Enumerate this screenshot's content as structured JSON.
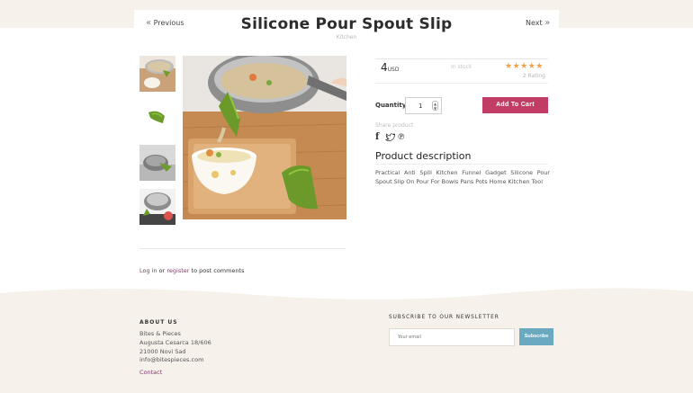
{
  "nav": {
    "previous": "Previous",
    "next": "Next",
    "prev_icon": "chevron-double-left-icon",
    "next_icon": "chevron-double-right-icon"
  },
  "product": {
    "title": "Silicone Pour Spout Slip",
    "category": "Kitchen",
    "price": "4",
    "currency": "USD",
    "stock": "In stock",
    "stars": "★★★★★",
    "rating_value": 5,
    "rating_text": "2 Rating",
    "quantity_label": "Quantity",
    "quantity": "1",
    "add_to_cart": "Add To Cart",
    "share_label": "Share product",
    "share_icons": [
      "facebook-icon",
      "twitter-icon",
      "pinterest-icon"
    ],
    "description_title": "Product description",
    "description": "Practical Anti Spill Kitchen Funnel Gadget Silicone Pour Spout Slip On Pour For Bowls Pans Pots Home Kitchen Tool"
  },
  "comments": {
    "login": "Log in",
    "or": " or ",
    "register": "register",
    "suffix": " to post comments"
  },
  "footer": {
    "about_title": "ABOUT US",
    "address": [
      "Bites & Pieces",
      "Augusta Cesarca 18/606",
      "21000 Novi Sad",
      "info@bitespieces.com"
    ],
    "contact": "Contact",
    "newsletter_title": "SUBSCRIBE TO OUR NEWSLETTER",
    "email_placeholder": "Your email",
    "subscribe": "Subscribe"
  },
  "colors": {
    "accent": "#c23d65",
    "link": "#7a3c66",
    "stars": "#f0a24a",
    "subscribe": "#6aa9c0",
    "footer_bg": "#f6f1ea"
  }
}
